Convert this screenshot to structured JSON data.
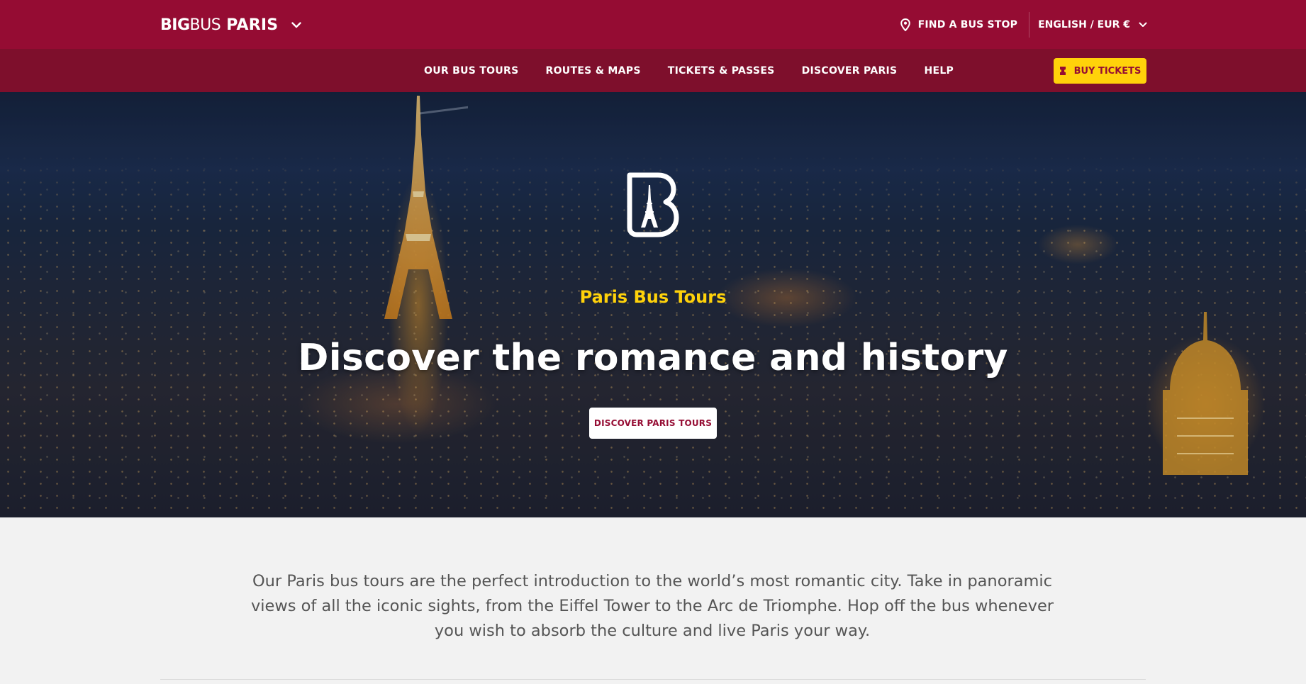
{
  "header": {
    "logo": {
      "big": "BIG",
      "bus": "BUS",
      "city": "PARIS"
    },
    "find_stop": "FIND A BUS STOP",
    "language": "ENGLISH / EUR €"
  },
  "nav": {
    "items": [
      {
        "label": "OUR BUS TOURS"
      },
      {
        "label": "ROUTES & MAPS"
      },
      {
        "label": "TICKETS & PASSES"
      },
      {
        "label": "DISCOVER PARIS"
      },
      {
        "label": "HELP"
      }
    ],
    "buy_label": "BUY TICKETS"
  },
  "hero": {
    "kicker": "Paris Bus Tours",
    "title": "Discover the romance and history",
    "cta": "DISCOVER PARIS TOURS"
  },
  "intro": {
    "text": "Our Paris bus tours are the perfect introduction to the world’s most romantic city. Take in panoramic views of all the iconic sights, from the Eiffel Tower to the Arc de Triomphe. Hop off the bus whenever you wish to absorb the culture and live Paris your way."
  },
  "colors": {
    "brand": "#950c33",
    "nav": "#7e0f2c",
    "accent": "#ffd20a",
    "background": "#f2f2f2"
  },
  "icons": {
    "logo_dropdown": "chevron-down-icon",
    "find_stop": "location-pin-icon",
    "language_dropdown": "chevron-down-icon",
    "buy": "ticket-icon",
    "hero_logo": "big-bus-b-eiffel-logo-icon"
  }
}
